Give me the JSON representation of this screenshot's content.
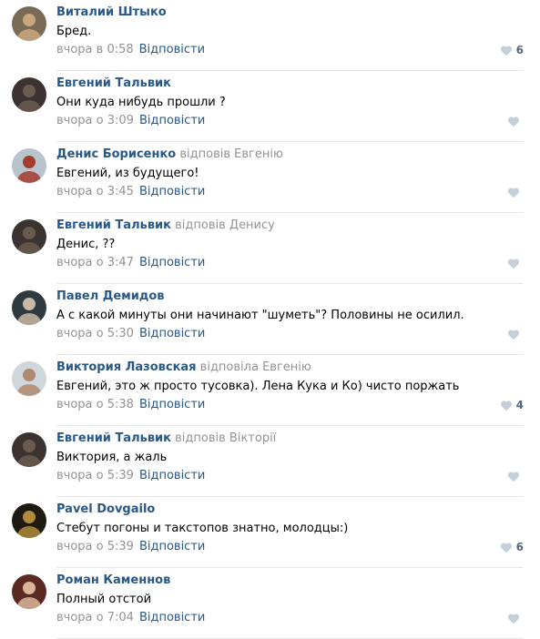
{
  "comments": [
    {
      "author": "Виталий Штыко",
      "reply_to": "",
      "text": "Бред.",
      "time": "вчора в 0:58",
      "reply_label": "Відповісти",
      "likes": "6",
      "avatar_colors": [
        "#7a6a55",
        "#c8a77e"
      ]
    },
    {
      "author": "Евгений Тальвик",
      "reply_to": "",
      "text": "Они куда нибудь прошли ?",
      "time": "вчора о 3:09",
      "reply_label": "Відповісти",
      "likes": "",
      "avatar_colors": [
        "#3a3330",
        "#6b5a4e"
      ]
    },
    {
      "author": "Денис Борисенко",
      "reply_to": "відповів Евгенію",
      "text": "Евгений, из будущего!",
      "time": "вчора о 3:45",
      "reply_label": "Відповісти",
      "likes": "",
      "avatar_colors": [
        "#b8c3cc",
        "#a33c2e"
      ]
    },
    {
      "author": "Евгений Тальвик",
      "reply_to": "відповів Денису",
      "text": "Денис, ??",
      "time": "вчора о 3:47",
      "reply_label": "Відповісти",
      "likes": "",
      "avatar_colors": [
        "#3a3330",
        "#6b5a4e"
      ]
    },
    {
      "author": "Павел Демидов",
      "reply_to": "",
      "text": "А с какой минуты они начинают \"шуметь\"? Половины не осилил.",
      "time": "вчора о 5:30",
      "reply_label": "Відповісти",
      "likes": "",
      "avatar_colors": [
        "#2e3a3f",
        "#c9b8a6"
      ]
    },
    {
      "author": "Виктория Лазовская",
      "reply_to": "відповіла Евгенію",
      "text": "Евгений, это ж просто тусовка). Лена Кука и Ко) чисто поржать",
      "time": "вчора о 5:38",
      "reply_label": "Відповісти",
      "likes": "4",
      "avatar_colors": [
        "#cfd6dc",
        "#b08a6e"
      ]
    },
    {
      "author": "Евгений Тальвик",
      "reply_to": "відповів Вікторії",
      "text": "Виктория, а жаль",
      "time": "вчора о 5:39",
      "reply_label": "Відповісти",
      "likes": "",
      "avatar_colors": [
        "#3a3330",
        "#6b5a4e"
      ]
    },
    {
      "author": "Pavel Dovgailo",
      "reply_to": "",
      "text": "Стебут погоны и такстопов знатно, молодцы:)",
      "time": "вчора о 5:39",
      "reply_label": "Відповісти",
      "likes": "6",
      "avatar_colors": [
        "#1e1a12",
        "#b08b3a"
      ]
    },
    {
      "author": "Роман Каменнов",
      "reply_to": "",
      "text": "Полный отстой",
      "time": "вчора о 7:04",
      "reply_label": "Відповісти",
      "likes": "",
      "avatar_colors": [
        "#5a2a22",
        "#d9b59a"
      ]
    }
  ],
  "colors": {
    "author": "#2a5885",
    "muted": "#939393",
    "like_heart": "#c5d0db",
    "like_count": "#55677d",
    "divider": "#e7e8ec"
  },
  "icons": {
    "like": "heart-icon"
  }
}
